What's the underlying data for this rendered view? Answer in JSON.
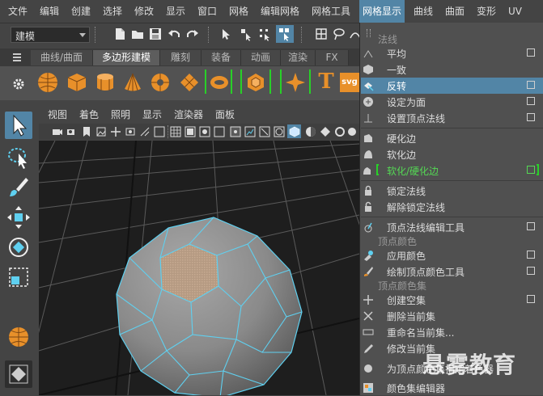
{
  "menubar": {
    "items": [
      "文件",
      "编辑",
      "创建",
      "选择",
      "修改",
      "显示",
      "窗口",
      "网格",
      "编辑网格",
      "网格工具",
      "网格显示",
      "曲线",
      "曲面",
      "变形",
      "UV"
    ],
    "active": "网格显示"
  },
  "toolbar": {
    "mode_value": "建模"
  },
  "shelf": {
    "tabs": [
      "曲线/曲面",
      "多边形建模",
      "雕刻",
      "装备",
      "动画",
      "渲染",
      "FX"
    ],
    "active_tab": "多边形建模",
    "icons": [
      "sphere-icon",
      "cube-icon",
      "cylinder-icon",
      "cone-icon",
      "torus-icon",
      "plane-icon",
      "combine-icon",
      "extract-icon",
      "bevel-icon",
      "type-icon",
      "svg-icon"
    ],
    "svg_text": "svg",
    "type_text": "T"
  },
  "panel": {
    "menus": [
      "视图",
      "着色",
      "照明",
      "显示",
      "渲染器",
      "面板"
    ]
  },
  "dropdown": {
    "sections": {
      "normals": "法线",
      "vertex_colors": "顶点颜色",
      "color_sets": "顶点颜色集"
    },
    "items": [
      {
        "label": "平均",
        "box": true
      },
      {
        "label": "一致",
        "box": false
      },
      {
        "label": "反转",
        "box": true,
        "highlighted": true
      },
      {
        "label": "设定为面",
        "box": true
      },
      {
        "label": "设置顶点法线",
        "box": true
      },
      {
        "label": "硬化边",
        "box": false
      },
      {
        "label": "软化边",
        "box": false
      },
      {
        "label": "软化/硬化边",
        "box": true,
        "green": true
      },
      {
        "label": "锁定法线",
        "box": false
      },
      {
        "label": "解除锁定法线",
        "box": false
      },
      {
        "label": "顶点法线编辑工具",
        "box": true
      },
      {
        "label": "应用颜色",
        "box": true
      },
      {
        "label": "绘制顶点颜色工具",
        "box": true
      },
      {
        "label": "创建空集",
        "box": true
      },
      {
        "label": "删除当前集",
        "box": false
      },
      {
        "label": "重命名当前集...",
        "box": false
      },
      {
        "label": "修改当前集",
        "box": false
      },
      {
        "label": "为顶点颜色集指定着色器",
        "box": false
      },
      {
        "label": "颜色集编辑器",
        "box": false
      }
    ]
  },
  "watermark": "悬雾教育",
  "colors": {
    "accent": "#5285a6",
    "green": "#54d854",
    "wire": "#5fd0f0"
  }
}
